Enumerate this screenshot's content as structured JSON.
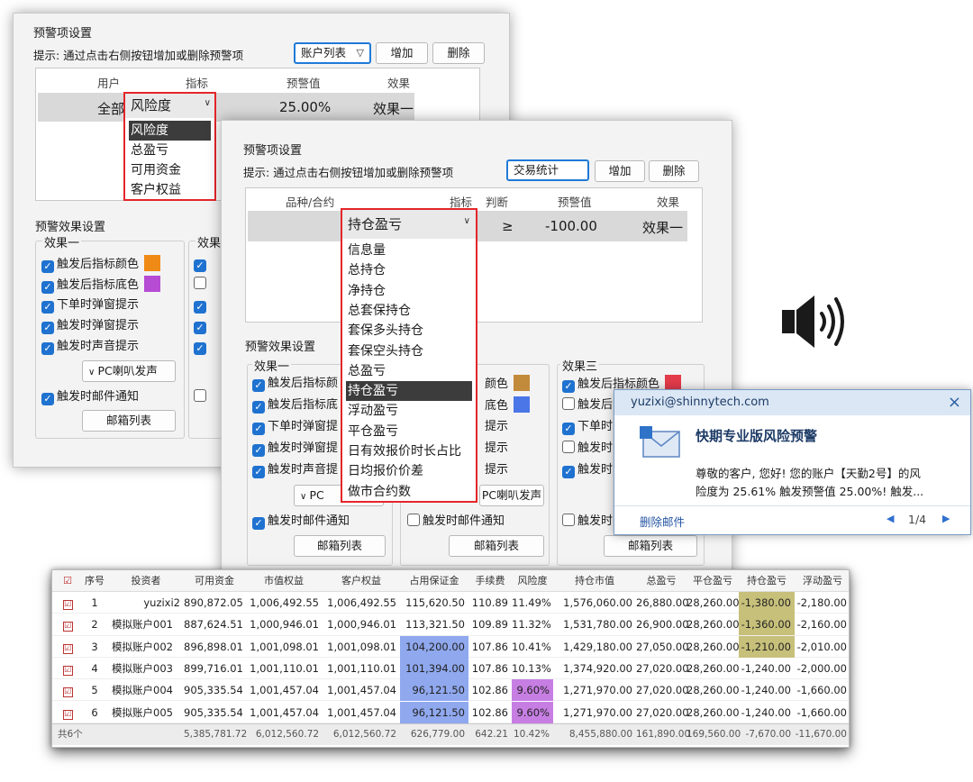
{
  "colors": {
    "accent_blue": "#1f7ad8",
    "highlight_red": "#e4262a",
    "orange": "#ef8a17",
    "purple": "#b64bd4",
    "brown": "#c28a3b",
    "blue_swatch": "#4b76e8",
    "red_swatch": "#e33b4a",
    "cell_blue": "#8fa8ee",
    "cell_purple": "#c77ee3",
    "cell_olive": "#c7c07a"
  },
  "back_panel": {
    "title": "预警项设置",
    "hint": "提示: 通过点击右侧按钮增加或删除预警项",
    "select_value": "账户列表",
    "add_label": "增加",
    "delete_label": "删除",
    "columns": [
      "用户",
      "指标",
      "预警值",
      "效果"
    ],
    "row": {
      "user": "全部",
      "indicator": "风险度",
      "threshold": "25.00%",
      "effect": "效果一"
    },
    "dropdown": [
      "风险度",
      "总盈亏",
      "可用资金",
      "客户权益"
    ],
    "effects_title": "预警效果设置",
    "group1_title": "效果一",
    "group2_title": "效果",
    "effect_rows": [
      "触发后指标颜色",
      "触发后指标底色",
      "下单时弹窗提示",
      "触发时弹窗提示",
      "触发时声音提示"
    ],
    "sound_option": "PC喇叭发声",
    "email_notify": "触发时邮件通知",
    "mailbox_list": "邮箱列表"
  },
  "front_panel": {
    "title": "预警项设置",
    "hint": "提示: 通过点击右侧按钮增加或删除预警项",
    "select_value": "交易统计",
    "add_label": "增加",
    "delete_label": "删除",
    "columns": [
      "品种/合约",
      "指标",
      "判断",
      "预警值",
      "效果"
    ],
    "row": {
      "indicator": "持仓盈亏",
      "compare": "≥",
      "threshold": "-100.00",
      "effect": "效果一"
    },
    "dropdown": [
      "信息量",
      "总持仓",
      "净持仓",
      "总套保持仓",
      "套保多头持仓",
      "套保空头持仓",
      "总盈亏",
      "持仓盈亏",
      "浮动盈亏",
      "平仓盈亏",
      "日有效报价时长占比",
      "日均报价价差",
      "做市合约数"
    ],
    "dropdown_selected_index": 7,
    "effects_title": "预警效果设置",
    "group1_title": "效果一",
    "group3_title": "效果三",
    "effect_rows": [
      "触发后指标颜",
      "触发后指标底",
      "下单时弹窗提",
      "触发时弹窗提",
      "触发时声音提"
    ],
    "mid_rows": [
      "颜色",
      "底色",
      "提示",
      "提示",
      "提示"
    ],
    "g3_rows": [
      "触发后指标颜色",
      "触发后",
      "下单时",
      "触发时",
      "触发时"
    ],
    "sound_left": "PC",
    "sound_mid": "PC喇叭发声",
    "email_notify": "触发时邮件通知",
    "mailbox_list": "邮箱列表"
  },
  "notification": {
    "sender": "yuzixi@shinnytech.com",
    "close": "×",
    "subject": "快期专业版风险预警",
    "body_line1": "尊敬的客户, 您好! 您的账户【天勤2号】的风",
    "body_line2": "险度为 25.61% 触发预警值 25.00%! 触发...",
    "delete_mail": "删除邮件",
    "pager": "1/4",
    "prev": "◀",
    "next": "▶"
  },
  "speaker_icon": "speaker-with-sound-waves",
  "table": {
    "columns": [
      "☑",
      "序号",
      "投资者",
      "可用资金",
      "市值权益",
      "客户权益",
      "占用保证金",
      "手续费",
      "风险度",
      "持仓市值",
      "总盈亏",
      "平仓盈亏",
      "持仓盈亏",
      "浮动盈亏"
    ],
    "rows": [
      [
        "☑",
        "1",
        "yuzixi2",
        "890,872.05",
        "1,006,492.55",
        "1,006,492.55",
        "115,620.50",
        "110.89",
        "11.49%",
        "1,576,060.00",
        "26,880.00",
        "28,260.00",
        "-1,380.00",
        "-2,180.00"
      ],
      [
        "☑",
        "2",
        "模拟账户001",
        "887,624.51",
        "1,000,946.01",
        "1,000,946.01",
        "113,321.50",
        "109.89",
        "11.32%",
        "1,531,780.00",
        "26,900.00",
        "28,260.00",
        "-1,360.00",
        "-2,160.00"
      ],
      [
        "☑",
        "3",
        "模拟账户002",
        "896,898.01",
        "1,001,098.01",
        "1,001,098.01",
        "104,200.00",
        "107.86",
        "10.41%",
        "1,429,180.00",
        "27,050.00",
        "28,260.00",
        "-1,210.00",
        "-2,010.00"
      ],
      [
        "☑",
        "4",
        "模拟账户003",
        "899,716.01",
        "1,001,110.01",
        "1,001,110.01",
        "101,394.00",
        "107.86",
        "10.13%",
        "1,374,920.00",
        "27,020.00",
        "28,260.00",
        "-1,240.00",
        "-2,000.00"
      ],
      [
        "☑",
        "5",
        "模拟账户004",
        "905,335.54",
        "1,001,457.04",
        "1,001,457.04",
        "96,121.50",
        "102.86",
        "9.60%",
        "1,271,970.00",
        "27,020.00",
        "28,260.00",
        "-1,240.00",
        "-1,660.00"
      ],
      [
        "☑",
        "6",
        "模拟账户005",
        "905,335.54",
        "1,001,457.04",
        "1,001,457.04",
        "96,121.50",
        "102.86",
        "9.60%",
        "1,271,970.00",
        "27,020.00",
        "28,260.00",
        "-1,240.00",
        "-1,660.00"
      ]
    ],
    "footer": [
      "共6个",
      "",
      "",
      "5,385,781.72",
      "6,012,560.72",
      "6,012,560.72",
      "626,779.00",
      "642.21",
      "10.42%",
      "8,455,880.00",
      "161,890.00",
      "169,560.00",
      "-7,670.00",
      "-11,670.00"
    ]
  }
}
